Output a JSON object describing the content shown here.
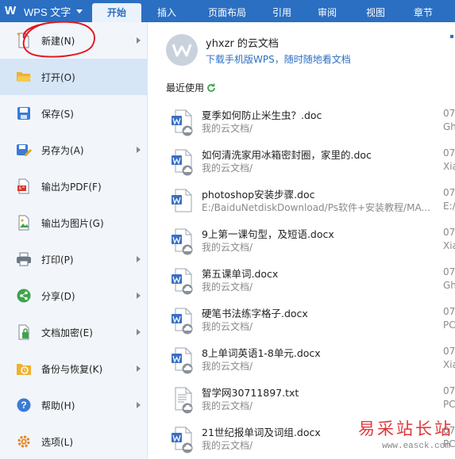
{
  "app": {
    "logo": "W",
    "name": "WPS 文字",
    "menu_icon": "chevron-down-icon"
  },
  "tabs": [
    {
      "label": "开始",
      "active": true
    },
    {
      "label": "插入"
    },
    {
      "label": "页面布局"
    },
    {
      "label": "引用"
    },
    {
      "label": "审阅"
    },
    {
      "label": "视图"
    },
    {
      "label": "章节"
    },
    {
      "label": "开"
    }
  ],
  "menu": [
    {
      "label": "新建(N)",
      "icon": "new-document-icon",
      "submenu": true
    },
    {
      "label": "打开(O)",
      "icon": "folder-open-icon",
      "submenu": false,
      "active": true
    },
    {
      "label": "保存(S)",
      "icon": "save-icon",
      "submenu": false
    },
    {
      "label": "另存为(A)",
      "icon": "save-as-icon",
      "submenu": true
    },
    {
      "label": "输出为PDF(F)",
      "icon": "pdf-export-icon",
      "submenu": false
    },
    {
      "label": "输出为图片(G)",
      "icon": "image-export-icon",
      "submenu": false
    },
    {
      "label": "打印(P)",
      "icon": "printer-icon",
      "submenu": true
    },
    {
      "label": "分享(D)",
      "icon": "share-icon",
      "submenu": true
    },
    {
      "label": "文档加密(E)",
      "icon": "lock-document-icon",
      "submenu": true
    },
    {
      "label": "备份与恢复(K)",
      "icon": "backup-restore-icon",
      "submenu": true
    },
    {
      "label": "帮助(H)",
      "icon": "help-icon",
      "submenu": true
    },
    {
      "label": "选项(L)",
      "icon": "gear-icon",
      "submenu": false
    }
  ],
  "account": {
    "user_name": "yhxzr 的云文档",
    "download_link": "下载手机版WPS，随时随地看文档"
  },
  "recent": {
    "heading": "最近使用",
    "files": [
      {
        "name": "夏季如何防止米生虫？.doc",
        "path": "我的云文档/",
        "date": "07",
        "location": "Gh"
      },
      {
        "name": "如何清洗家用冰箱密封圈，家里的.doc",
        "path": "我的云文档/",
        "date": "07",
        "location": "Xia"
      },
      {
        "name": "photoshop安装步骤.doc",
        "path": "E:/BaiduNetdiskDownload/Ps软件+安装教程/MA...",
        "date": "07",
        "location": "E:/"
      },
      {
        "name": "9上第一课句型，及短语.docx",
        "path": "我的云文档/",
        "date": "07",
        "location": "Xia"
      },
      {
        "name": "第五课单词.docx",
        "path": "我的云文档/",
        "date": "07",
        "location": "Gh"
      },
      {
        "name": "硬笔书法练字格子.docx",
        "path": "我的云文档/",
        "date": "07",
        "location": "PC"
      },
      {
        "name": "8上单词英语1-8单元.docx",
        "path": "我的云文档/",
        "date": "07",
        "location": "Xia"
      },
      {
        "name": "智学网30711897.txt",
        "path": "我的云文档/",
        "date": "07",
        "location": "PC"
      },
      {
        "name": "21世纪报单词及词组.docx",
        "path": "我的云文档/",
        "date": "07",
        "location": "PC"
      }
    ]
  },
  "watermark": {
    "text": "易采站长站",
    "url": "www.easck.com"
  },
  "colors": {
    "brand_blue": "#2b6fc2",
    "annotation_red": "#e0191f"
  }
}
